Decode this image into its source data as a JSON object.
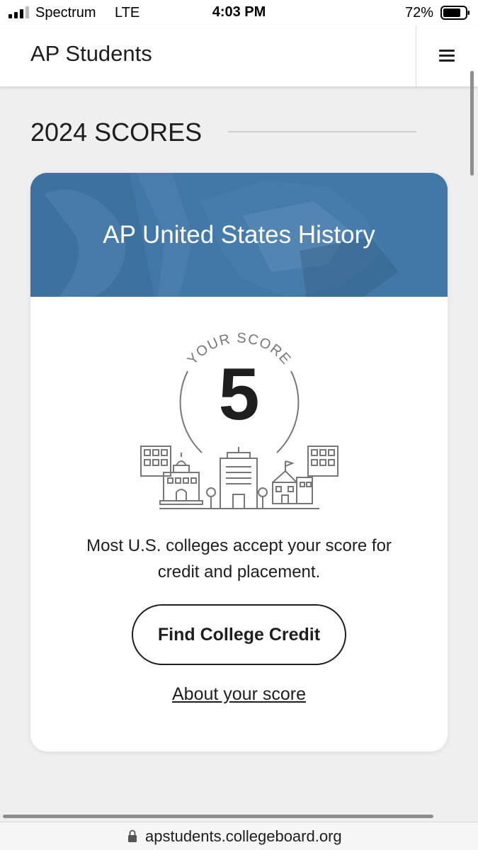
{
  "status_bar": {
    "carrier": "Spectrum",
    "network": "LTE",
    "time": "4:03 PM",
    "battery_percent": "72%"
  },
  "header": {
    "title": "AP Students",
    "menu_icon": "hamburger-menu-icon"
  },
  "section": {
    "heading": "2024 SCORES"
  },
  "score_card": {
    "course_title": "AP United States History",
    "score_caption": "YOUR SCORE",
    "score": "5",
    "message": "Most U.S. colleges accept your score for credit and placement.",
    "primary_button": "Find College Credit",
    "secondary_link": "About your score",
    "banner_color": "#4178a8"
  },
  "browser": {
    "url": "apstudents.collegeboard.org",
    "lock_icon": "lock-icon"
  }
}
